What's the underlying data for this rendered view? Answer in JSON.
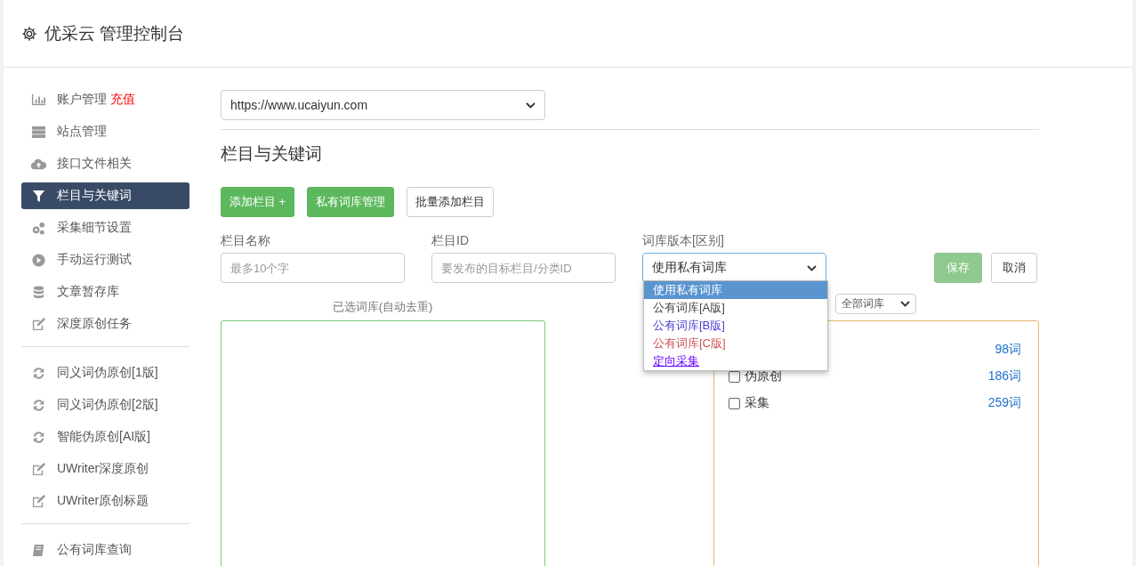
{
  "header": {
    "title": "优采云 管理控制台"
  },
  "sidebar": {
    "sections": [
      {
        "items": [
          {
            "label": "账户管理",
            "badge": "充值",
            "selected": false
          },
          {
            "label": "站点管理",
            "selected": false
          },
          {
            "label": "接口文件相关",
            "selected": false
          },
          {
            "label": "栏目与关键词",
            "selected": true
          },
          {
            "label": "采集细节设置",
            "selected": false
          },
          {
            "label": "手动运行测试",
            "selected": false
          },
          {
            "label": "文章暂存库",
            "selected": false
          },
          {
            "label": "深度原创任务",
            "selected": false
          }
        ]
      },
      {
        "items": [
          {
            "label": "同义词伪原创[1版]",
            "selected": false
          },
          {
            "label": "同义词伪原创[2版]",
            "selected": false
          },
          {
            "label": "智能伪原创[AI版]",
            "selected": false
          },
          {
            "label": "UWriter深度原创",
            "selected": false
          },
          {
            "label": "UWriter原创标题",
            "selected": false
          }
        ]
      },
      {
        "items": [
          {
            "label": "公有词库查询",
            "selected": false
          }
        ]
      }
    ]
  },
  "site_select": {
    "value": "https://www.ucaiyun.com"
  },
  "section_title": "栏目与关键词",
  "buttons": [
    {
      "label": "添加栏目 +",
      "kind": "primary"
    },
    {
      "label": "私有词库管理",
      "kind": "primary"
    },
    {
      "label": "批量添加栏目",
      "kind": "default"
    }
  ],
  "form": {
    "fields": [
      {
        "label": "栏目名称",
        "kind": "input",
        "placeholder": "最多10个字"
      },
      {
        "label": "栏目ID",
        "kind": "input",
        "placeholder": "要发布的目标栏目/分类ID"
      },
      {
        "label": "词库版本[区别]",
        "kind": "select",
        "value": "使用私有词库"
      }
    ],
    "save": "保存",
    "cancel": "取消"
  },
  "dropdown": {
    "options": [
      {
        "label": "使用私有词库",
        "selected": true
      },
      {
        "label": "公有词库[A版]",
        "selected": false,
        "color": "#444444"
      },
      {
        "label": "公有词库[B版]",
        "selected": false,
        "color": "#4b3fd6"
      },
      {
        "label": "公有词库[C版]",
        "selected": false,
        "color": "#d05050"
      },
      {
        "label": "定向采集",
        "selected": false,
        "color": "#6a00ff"
      }
    ]
  },
  "selected_label": "已选词库(自动去重)",
  "library_filter": {
    "value": "全部词库"
  },
  "libraries": [
    {
      "count": "98词"
    },
    {
      "name": "伪原创",
      "count": "186词",
      "checked": false
    },
    {
      "name": "采集",
      "count": "259词",
      "checked": false
    }
  ]
}
